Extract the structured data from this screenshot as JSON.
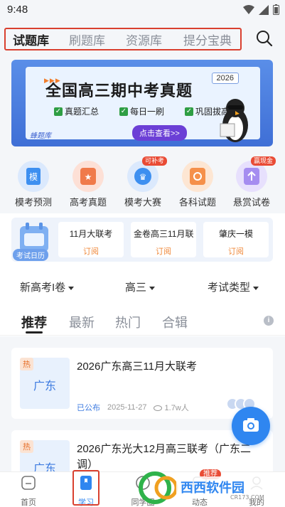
{
  "status": {
    "time": "9:48"
  },
  "header": {
    "tabs": [
      {
        "label": "试题库",
        "active": true
      },
      {
        "label": "刷题库",
        "active": false
      },
      {
        "label": "资源库",
        "active": false
      },
      {
        "label": "提分宝典",
        "active": false
      }
    ]
  },
  "banner": {
    "title": "全国高三期中考真题",
    "year": "2026",
    "features": [
      "真题汇总",
      "每日一刷",
      "巩固拔高"
    ],
    "cta": "点击查看>>",
    "brand": "蜂题库"
  },
  "quick": [
    {
      "label": "模考预测",
      "icon": "exam-predict-icon",
      "color": "#3d8ff0",
      "glyph": "模"
    },
    {
      "label": "高考真题",
      "icon": "gaokao-icon",
      "color": "#f07a4a",
      "glyph": "★"
    },
    {
      "label": "模考大赛",
      "icon": "contest-icon",
      "color": "#3d8ff0",
      "badge": "可补考",
      "glyph": "♛"
    },
    {
      "label": "各科试题",
      "icon": "subjects-icon",
      "color": "#f5904a",
      "glyph": "Q"
    },
    {
      "label": "悬赏试卷",
      "icon": "reward-icon",
      "color": "#a58df0",
      "badge": "赢现金",
      "glyph": "↑"
    }
  ],
  "calendar": {
    "label": "考试日历",
    "items": [
      {
        "title": "11月大联考",
        "action": "订阅"
      },
      {
        "title": "金卷高三11月联",
        "action": "订阅"
      },
      {
        "title": "肇庆一模",
        "action": "订阅"
      }
    ]
  },
  "filters": [
    "新高考I卷",
    "高三",
    "考试类型"
  ],
  "content_tabs": [
    {
      "label": "推荐",
      "active": true
    },
    {
      "label": "最新",
      "active": false
    },
    {
      "label": "热门",
      "active": false
    },
    {
      "label": "合辑",
      "active": false
    }
  ],
  "items": [
    {
      "hot": "热",
      "thumb": "广东",
      "title": "2026广东高三11月大联考",
      "status": "已公布",
      "date": "2025-11-27",
      "views": "1.7w人"
    },
    {
      "hot": "热",
      "thumb": "广东",
      "title": "2026广东光大12月高三联考（广东二调）"
    }
  ],
  "nav": [
    {
      "label": "首页",
      "active": false
    },
    {
      "label": "学习",
      "active": true
    },
    {
      "label": "同学圈",
      "active": false
    },
    {
      "label": "动态",
      "active": false,
      "badge": "推荐"
    },
    {
      "label": "我的",
      "active": false
    }
  ],
  "watermark": {
    "text": "西西软件园",
    "site": "CR173.COM"
  }
}
